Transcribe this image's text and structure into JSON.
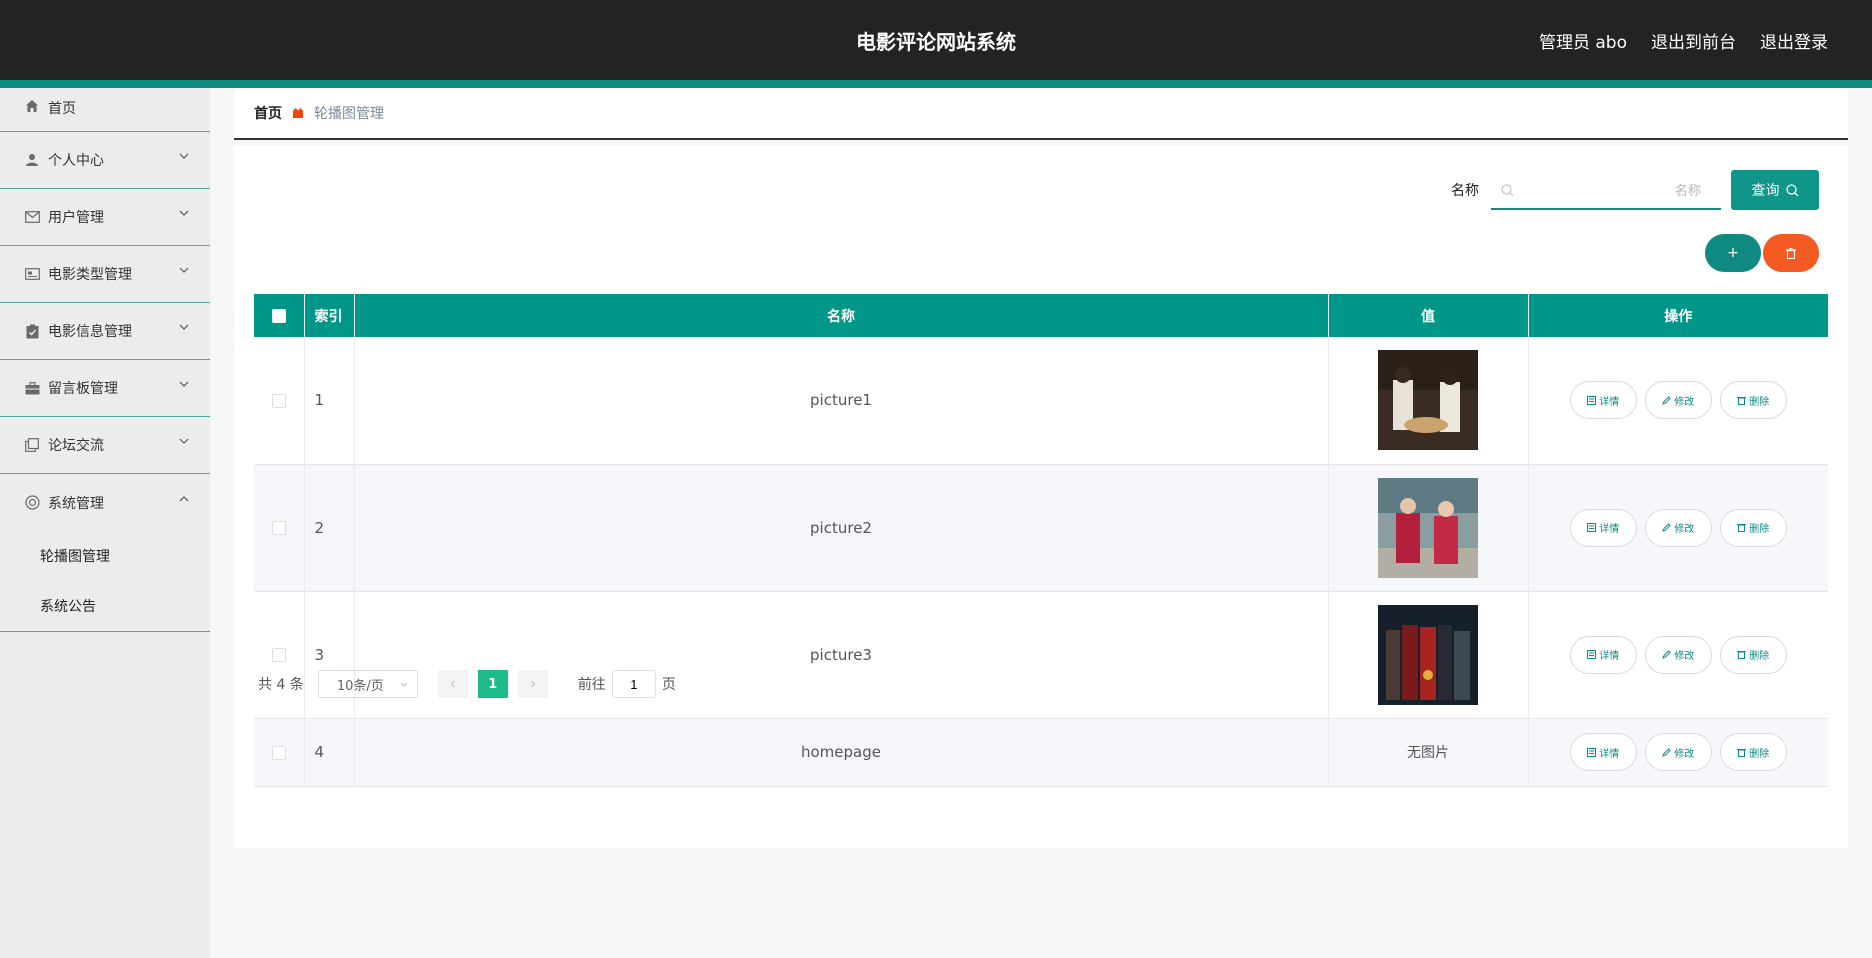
{
  "header": {
    "title": "电影评论网站系统",
    "admin_label": "管理员 abo",
    "front_label": "退出到前台",
    "logout_label": "退出登录",
    "bg_color": "#232323",
    "accent_color": "#0f8a80"
  },
  "sidebar": {
    "items": [
      {
        "label": "首页",
        "icon": "home-icon"
      },
      {
        "label": "个人中心",
        "icon": "user-icon"
      },
      {
        "label": "用户管理",
        "icon": "mail-icon"
      },
      {
        "label": "电影类型管理",
        "icon": "card-icon"
      },
      {
        "label": "电影信息管理",
        "icon": "clipboard-icon"
      },
      {
        "label": "留言板管理",
        "icon": "briefcase-icon"
      },
      {
        "label": "论坛交流",
        "icon": "copy-icon"
      },
      {
        "label": "系统管理",
        "icon": "settings-icon",
        "expanded": true
      }
    ],
    "sub_items": [
      {
        "label": "轮播图管理",
        "active": true
      },
      {
        "label": "系统公告",
        "active": false
      }
    ]
  },
  "breadcrumb": {
    "home": "首页",
    "current": "轮播图管理"
  },
  "search": {
    "label": "名称",
    "placeholder": "名称",
    "button_label": "查询"
  },
  "toolbar": {
    "add_label": "+",
    "add_color": "#0f8a80",
    "delete_color": "#f55a23"
  },
  "table": {
    "headers": {
      "index": "索引",
      "name": "名称",
      "value": "值",
      "ops": "操作"
    },
    "header_color": "#009688",
    "rows": [
      {
        "index": "1",
        "name": "picture1",
        "value": "",
        "has_image": true
      },
      {
        "index": "2",
        "name": "picture2",
        "value": "",
        "has_image": true
      },
      {
        "index": "3",
        "name": "picture3",
        "value": "",
        "has_image": true
      },
      {
        "index": "4",
        "name": "homepage",
        "value": "无图片",
        "has_image": false
      }
    ],
    "op_labels": {
      "detail": "详情",
      "edit": "修改",
      "delete": "删除"
    }
  },
  "pager": {
    "total": "共 4 条",
    "page_size": "10条/页",
    "current_page": "1",
    "goto_prefix": "前往",
    "goto_value": "1",
    "goto_suffix": "页"
  }
}
